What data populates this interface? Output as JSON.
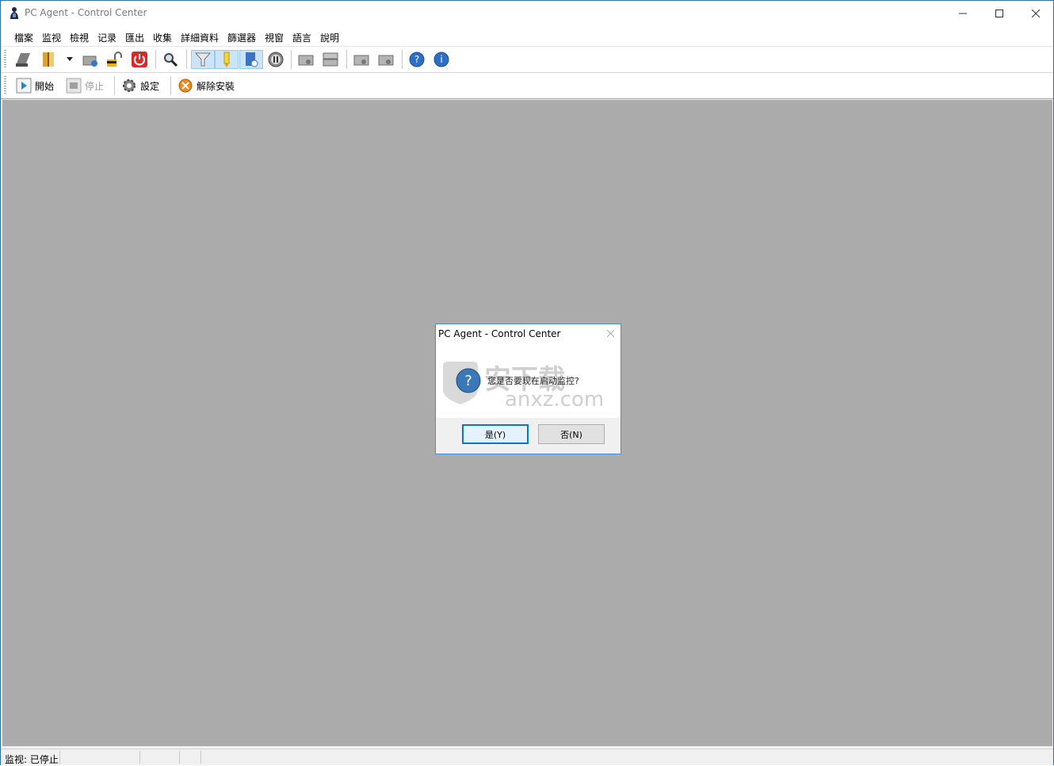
{
  "window": {
    "title": "PC Agent - Control Center"
  },
  "menu": [
    "檔案",
    "监视",
    "檢視",
    "记录",
    "匯出",
    "收集",
    "詳細資料",
    "篩選器",
    "視窗",
    "語言",
    "說明"
  ],
  "toolbar2": {
    "start": "開始",
    "stop": "停止",
    "settings": "設定",
    "uninstall": "解除安裝"
  },
  "dialog": {
    "title": "PC Agent - Control Center",
    "message": "您是否要现在启动监控?",
    "yes": "是(Y)",
    "no": "否(N)",
    "watermark": "安下载",
    "watermark_sub": "anxz.com"
  },
  "status": {
    "text": "监视: 已停止"
  }
}
